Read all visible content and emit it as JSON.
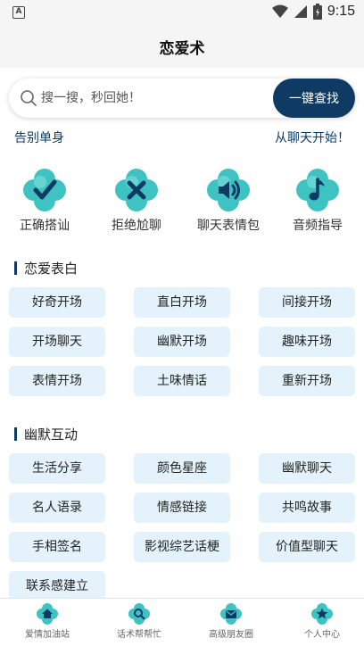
{
  "status": {
    "time": "9:15",
    "notification_letter": "A"
  },
  "app": {
    "title": "恋爱术"
  },
  "search": {
    "placeholder": "搜一搜，秒回她！",
    "button_label": "一键查找"
  },
  "taglines": {
    "left": "告别单身",
    "right": "从聊天开始！"
  },
  "features": [
    {
      "label": "正确搭讪",
      "icon": "checkmark-icon"
    },
    {
      "label": "拒绝尬聊",
      "icon": "cross-icon"
    },
    {
      "label": "聊天表情包",
      "icon": "speaker-icon"
    },
    {
      "label": "音频指导",
      "icon": "music-note-icon"
    }
  ],
  "sections": [
    {
      "title": "恋爱表白",
      "items": [
        "好奇开场",
        "直白开场",
        "间接开场",
        "开场聊天",
        "幽默开场",
        "趣味开场",
        "表情开场",
        "土味情话",
        "重新开场"
      ]
    },
    {
      "title": "幽默互动",
      "items": [
        "生活分享",
        "颜色星座",
        "幽默聊天",
        "名人语录",
        "情感链接",
        "共鸣故事",
        "手相签名",
        "影视综艺话梗",
        "价值型聊天",
        "联系感建立"
      ]
    }
  ],
  "bottom_nav": [
    {
      "label": "爱情加油站",
      "icon": "home-icon"
    },
    {
      "label": "话术帮帮忙",
      "icon": "search-icon"
    },
    {
      "label": "高级朋友圈",
      "icon": "mail-icon"
    },
    {
      "label": "个人中心",
      "icon": "star-icon"
    }
  ],
  "colors": {
    "accent": "#0e3a63",
    "chip_bg": "#e4f3fb",
    "icon_teal": "#3fc2c2"
  }
}
